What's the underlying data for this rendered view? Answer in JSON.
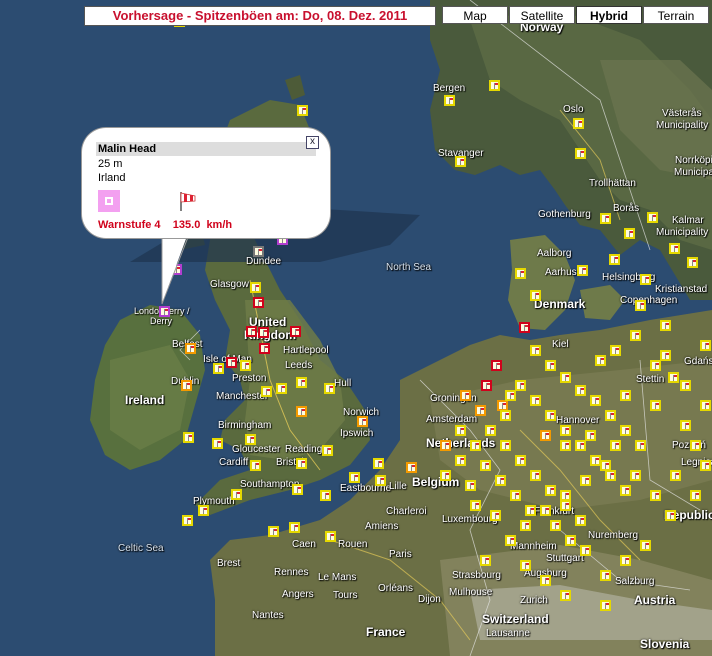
{
  "title": "Vorhersage - Spitzenböen am: Do, 08. Dez. 2011",
  "map_types": [
    {
      "label": "Map",
      "active": false
    },
    {
      "label": "Satellite",
      "active": false
    },
    {
      "label": "Hybrid",
      "active": true
    },
    {
      "label": "Terrain",
      "active": false
    }
  ],
  "info_window": {
    "station": "Malin Head",
    "elevation": "25 m",
    "country": "Irland",
    "warning_level": "Warnstufe 4",
    "gust": "135.0",
    "unit": "km/h",
    "close_symbol": "x",
    "warning_color": "#f3a0f0"
  },
  "labels": {
    "norway": "Norway",
    "bergen": "Bergen",
    "oslo": "Oslo",
    "stavanger": "Stavanger",
    "vasteras": "Västerås",
    "vasteras_mun": "Municipality",
    "norrkoping": "Norrköping",
    "norrkoping_mun": "Municipality",
    "trollhattan": "Trollhättan",
    "boras": "Borås",
    "gothenburg": "Gothenburg",
    "kalmar": "Kalmar",
    "kalmar_mun": "Municipality",
    "aalborg": "Aalborg",
    "aarhus": "Aarhus",
    "helsingborg": "Helsingborg",
    "kristianstad": "Kristianstad",
    "denmark": "Denmark",
    "copenhagen": "Copenhagen",
    "north_sea": "North Sea",
    "dundee": "Dundee",
    "glasgow": "Glasgow",
    "londonderry": "Londonderry /",
    "derry": "Derry",
    "united": "United",
    "kingdom": "Kingdom",
    "hartlepool": "Hartlepool",
    "belfast": "Belfast",
    "isle_of_man": "Isle of Man",
    "preston": "Preston",
    "leeds": "Leeds",
    "hull": "Hull",
    "dublin": "Dublin",
    "ireland": "Ireland",
    "manchester": "Manchester",
    "birmingham": "Birmingham",
    "norwich": "Norwich",
    "ipswich": "Ipswich",
    "gloucester": "Gloucester",
    "reading": "Reading",
    "cardiff": "Cardiff",
    "bristol": "Bristol",
    "southampton": "Southampton",
    "eastbourne": "Eastbourne",
    "plymouth": "Plymouth",
    "celtic_sea": "Celtic Sea",
    "kiel": "Kiel",
    "groningen": "Groningen",
    "amsterdam": "Amsterdam",
    "netherlands": "Netherlands",
    "hannover": "Hannover",
    "stettin": "Stettin",
    "poznan": "Poznań",
    "lille": "Lille",
    "belgium": "Belgium",
    "charleroi": "Charleroi",
    "luxembourg": "Luxembourg",
    "frankfurt": "Frankfurt",
    "nuremberg": "Nuremberg",
    "mannheim": "Mannheim",
    "stuttgart": "Stuttgart",
    "augsburg": "Augsburg",
    "strasbourg": "Strasbourg",
    "zurich": "Zurich",
    "switzerland": "Switzerland",
    "lausanne": "Lausanne",
    "salzburg": "Salzburg",
    "austria": "Austria",
    "republic": "Republic",
    "slovenia": "Slovenia",
    "brest": "Brest",
    "caen": "Caen",
    "rouen": "Rouen",
    "paris": "Paris",
    "amiens": "Amiens",
    "rennes": "Rennes",
    "le_mans": "Le Mans",
    "orleans": "Orléans",
    "angers": "Angers",
    "tours": "Tours",
    "dijon": "Dijon",
    "mulhouse": "Mulhouse",
    "nantes": "Nantes",
    "france": "France",
    "legnica": "Legnica",
    "gdansk": "Gdańsk"
  }
}
